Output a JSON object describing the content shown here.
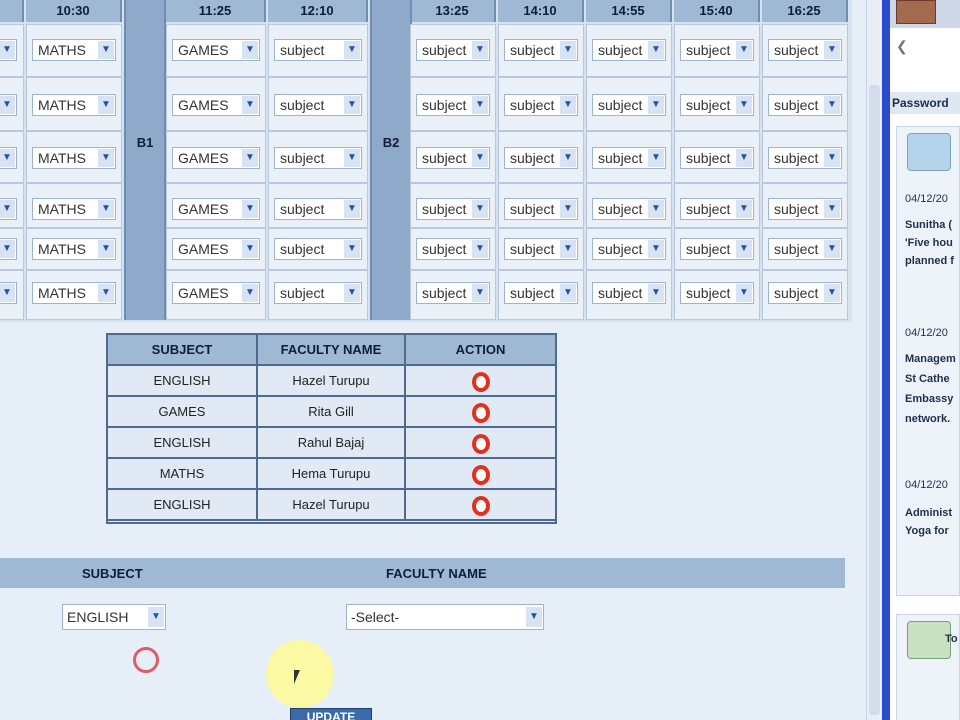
{
  "timetable": {
    "times": [
      "10:30",
      "11:25",
      "12:10",
      "13:25",
      "14:10",
      "14:55",
      "15:40",
      "16:25"
    ],
    "break1_label": "B1",
    "break2_label": "B2",
    "dropdown_placeholder": "subject",
    "rows": [
      [
        "MATHS",
        "GAMES",
        "subject",
        "subject",
        "subject",
        "subject",
        "subject",
        "subject"
      ],
      [
        "MATHS",
        "GAMES",
        "subject",
        "subject",
        "subject",
        "subject",
        "subject",
        "subject"
      ],
      [
        "MATHS",
        "GAMES",
        "subject",
        "subject",
        "subject",
        "subject",
        "subject",
        "subject"
      ],
      [
        "MATHS",
        "GAMES",
        "subject",
        "subject",
        "subject",
        "subject",
        "subject",
        "subject"
      ],
      [
        "MATHS",
        "GAMES",
        "subject",
        "subject",
        "subject",
        "subject",
        "subject",
        "subject"
      ],
      [
        "MATHS",
        "GAMES",
        "subject",
        "subject",
        "subject",
        "subject",
        "subject",
        "subject"
      ]
    ]
  },
  "assignments": {
    "headers": [
      "SUBJECT",
      "FACULTY NAME",
      "ACTION"
    ],
    "rows": [
      {
        "subject": "ENGLISH",
        "faculty": "Hazel Turupu"
      },
      {
        "subject": "GAMES",
        "faculty": "Rita Gill"
      },
      {
        "subject": "ENGLISH",
        "faculty": "Rahul Bajaj"
      },
      {
        "subject": "MATHS",
        "faculty": "Hema Turupu"
      },
      {
        "subject": "ENGLISH",
        "faculty": "Hazel Turupu"
      }
    ],
    "action_icon": "delete-icon"
  },
  "form": {
    "subject_label": "SUBJECT",
    "faculty_label": "FACULTY NAME",
    "subject_value": "ENGLISH",
    "faculty_value": "-Select-",
    "update_label": "UPDATE"
  },
  "sidebar": {
    "password_label": "Password",
    "back_arrow": "❮",
    "items": [
      {
        "date": "04/12/20",
        "author": "Sunitha (",
        "line1": "'Five hou",
        "line2": "planned f"
      },
      {
        "date": "04/12/20",
        "line1": "Managem",
        "line2": "St Cathe",
        "line3": "Embassy",
        "line4": "network."
      },
      {
        "date": "04/12/20",
        "line1": "Administ",
        "line2": "Yoga for"
      }
    ],
    "panel2_label": "To"
  },
  "colors": {
    "header_bg": "#9fb8d4",
    "break_bg": "#8ea9c9",
    "delete_red": "#e2301e",
    "accent_blue": "#2a4bd0"
  }
}
